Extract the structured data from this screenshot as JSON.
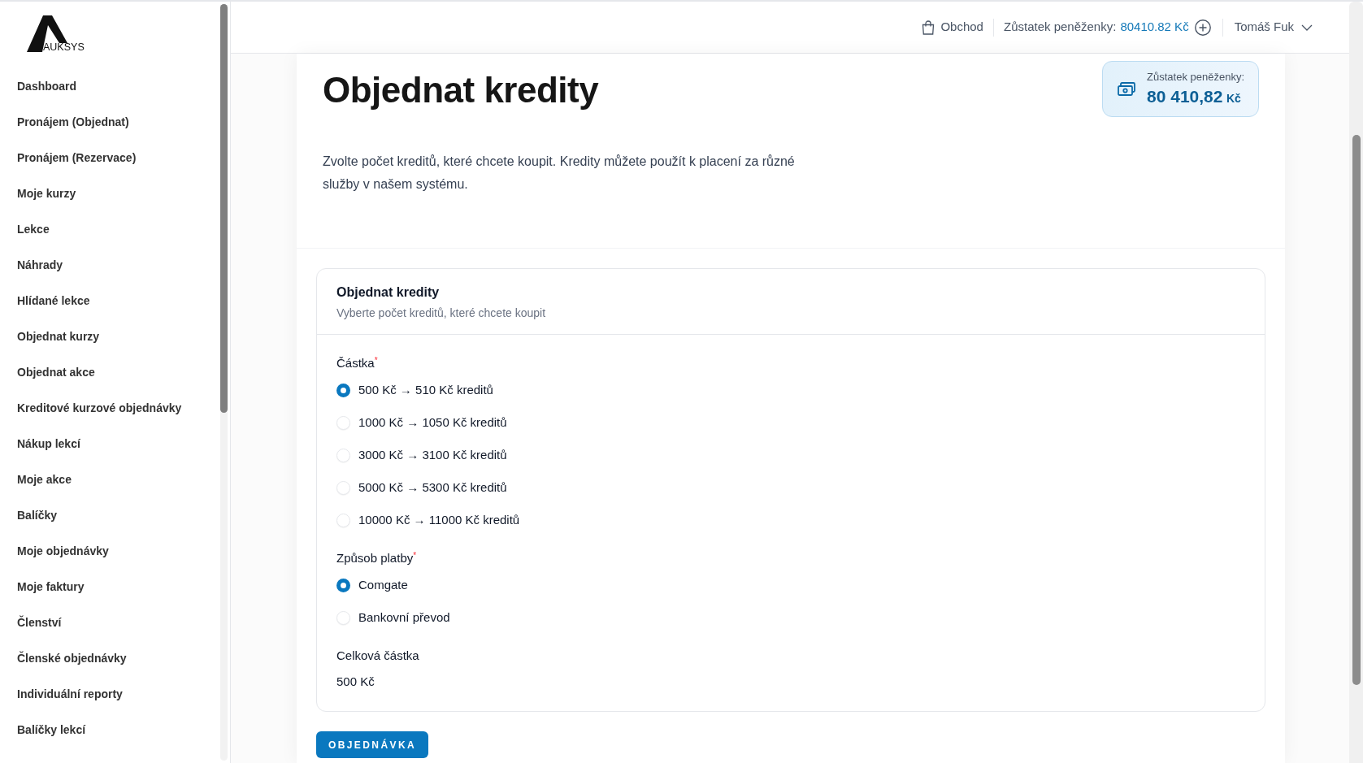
{
  "sidebar": {
    "logo": {
      "text": "AUKSYS"
    },
    "items": [
      "Dashboard",
      "Pronájem (Objednat)",
      "Pronájem (Rezervace)",
      "Moje kurzy",
      "Lekce",
      "Náhrady",
      "Hlídané lekce",
      "Objednat kurzy",
      "Objednat akce",
      "Kreditové kurzové objednávky",
      "Nákup lekcí",
      "Moje akce",
      "Balíčky",
      "Moje objednávky",
      "Moje faktury",
      "Členství",
      "Členské objednávky",
      "Individuální reporty",
      "Balíčky lekcí"
    ]
  },
  "top_bar": {
    "shop_link": "Obchod",
    "wallet": {
      "label": "Zůstatek peněženky:",
      "value": "80410.82 Kč"
    },
    "user": "Tomáš Fuk"
  },
  "page": {
    "title": "Objednat kredity",
    "balance_card": {
      "label": "Zůstatek peněženky:",
      "amount": "80 410,82",
      "currency": "Kč"
    },
    "description": "Zvolte počet kreditů, které chcete koupit. Kredity můžete použít k placení za různé služby v našem systému."
  },
  "order_form": {
    "title": "Objednat kredity",
    "subtitle": "Vyberte počet kreditů, které chcete koupit",
    "fields": [
      {
        "kind": "radio",
        "label": "Částka$^{*}$",
        "options": [
          {
            "label": "500 Kč → 510 Kč kreditů",
            "selected": true
          },
          {
            "label": "1000 Kč → 1050 Kč kreditů",
            "selected": false
          },
          {
            "label": "3000 Kč → 3100 Kč kreditů",
            "selected": false
          },
          {
            "label": "5000 Kč → 5300 Kč kreditů",
            "selected": false
          },
          {
            "label": "10000 Kč → 11000 Kč kreditů",
            "selected": false
          }
        ]
      },
      {
        "kind": "radio",
        "label": "Způsob platby$^{*}$",
        "options": [
          {
            "label": "Comgate",
            "selected": true
          },
          {
            "label": "Bankovní převod",
            "selected": false
          }
        ]
      },
      {
        "kind": "text",
        "label": "Celková částka",
        "value": "500 Kč"
      }
    ],
    "submit_button": "OBJEDNÁVKA"
  }
}
